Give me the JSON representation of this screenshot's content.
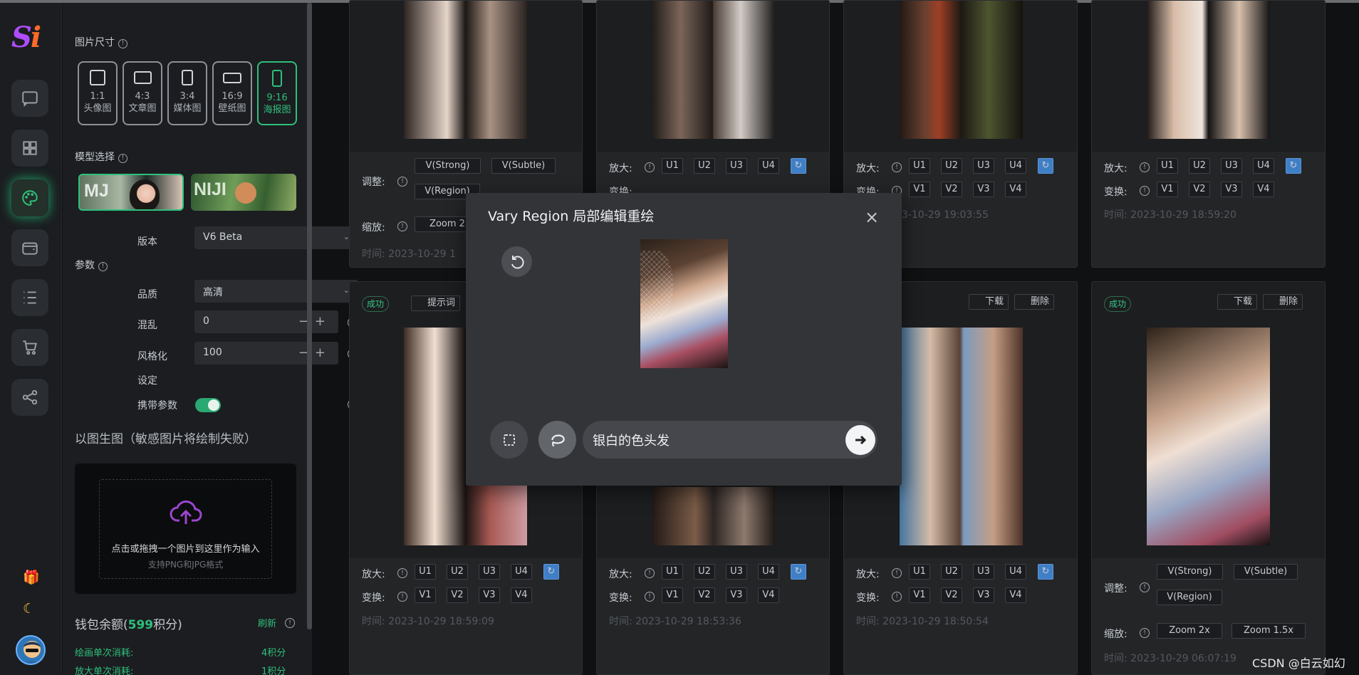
{
  "sidebar": {
    "logo": "Si",
    "items": [
      "chat",
      "apps",
      "palette",
      "wallet",
      "menu",
      "cart",
      "share"
    ],
    "small_icons": [
      "gift-icon",
      "moon-icon"
    ]
  },
  "settings": {
    "image_size": {
      "title": "图片尺寸",
      "options": [
        {
          "ratio": "1:1",
          "label": "头像图"
        },
        {
          "ratio": "4:3",
          "label": "文章图"
        },
        {
          "ratio": "3:4",
          "label": "媒体图"
        },
        {
          "ratio": "16:9",
          "label": "壁纸图"
        },
        {
          "ratio": "9:16",
          "label": "海报图"
        }
      ]
    },
    "model": {
      "title": "模型选择",
      "options": [
        "MJ",
        "NIJI"
      ]
    },
    "version": {
      "label": "版本",
      "value": "V6 Beta"
    },
    "params": {
      "label": "参数"
    },
    "quality": {
      "label": "品质",
      "value": "高清"
    },
    "chaos": {
      "label": "混乱",
      "value": "0"
    },
    "stylize": {
      "label": "风格化",
      "value": "100"
    },
    "settings_label": "设定",
    "carry_params": {
      "label": "携带参数",
      "enabled": true
    },
    "img2img": {
      "title": "以图生图（敏感图片将绘制失败）",
      "upload_text": "点击或拖拽一个图片到这里作为输入",
      "upload_hint": "支持PNG和JPG格式"
    },
    "wallet": {
      "prefix": "钱包余额(",
      "points": "599",
      "suffix": "积分)",
      "refresh": "刷新"
    },
    "draw_cost": {
      "label": "绘画单次消耗:",
      "value": "4积分"
    },
    "upscale_cost": {
      "label": "放大单次消耗:",
      "value": "1积分"
    }
  },
  "gallery": {
    "labels": {
      "adjust": "调整:",
      "zoom": "缩放:",
      "upscale": "放大:",
      "vary": "变换:",
      "success": "成功",
      "prompt": "提示词",
      "download": "下载",
      "delete": "删除",
      "v_strong": "V(Strong)",
      "v_subtle": "V(Subtle)",
      "v_region": "V(Region)",
      "zoom2": "Zoom 2x",
      "zoom15": "Zoom 1.5x",
      "zoom_short": "Zoom 2"
    },
    "u_buttons": [
      "U1",
      "U2",
      "U3",
      "U4"
    ],
    "v_buttons": [
      "V1",
      "V2",
      "V3",
      "V4"
    ],
    "times": [
      "时间: 2023-10-29 1",
      "时间: 2023-10-29 19:03:55",
      "时间: 2023-10-29 18:59:20",
      "时间: 2023-10-29 18:59:09",
      "时间: 2023-10-29 18:53:36",
      "时间: 2023-10-29 18:50:54",
      "时间: 2023-10-29 06:07:19"
    ]
  },
  "modal": {
    "title": "Vary Region 局部编辑重绘",
    "prompt_value": "银白的色头发"
  },
  "watermark": "CSDN @白云如幻"
}
